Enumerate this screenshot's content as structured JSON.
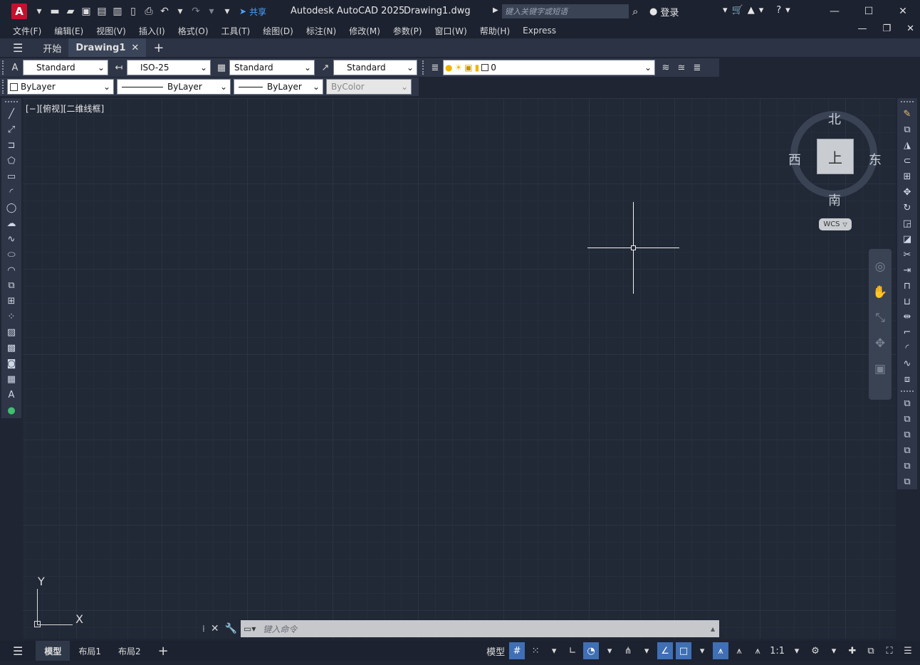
{
  "titlebar": {
    "logo": "A",
    "share_label": "共享",
    "app_title": "Autodesk AutoCAD 2025",
    "doc_title": "Drawing1.dwg",
    "search_placeholder": "键入关键字或短语",
    "login_label": "登录"
  },
  "menu": {
    "items": [
      "文件(F)",
      "编辑(E)",
      "视图(V)",
      "插入(I)",
      "格式(O)",
      "工具(T)",
      "绘图(D)",
      "标注(N)",
      "修改(M)",
      "参数(P)",
      "窗口(W)",
      "帮助(H)",
      "Express"
    ]
  },
  "tabs": {
    "start": "开始",
    "drawing": "Drawing1"
  },
  "toolbar1": {
    "text_style": "Standard",
    "dim_style": "ISO-25",
    "table_style": "Standard",
    "mleader_style": "Standard",
    "layer": "0"
  },
  "toolbar2": {
    "color": "ByLayer",
    "linetype": "ByLayer",
    "lineweight": "ByLayer",
    "plotstyle": "ByColor"
  },
  "viewport": {
    "label": "[−][俯视][二维线框]"
  },
  "viewcube": {
    "north": "北",
    "south": "南",
    "east": "东",
    "west": "西",
    "face": "上",
    "wcs": "WCS"
  },
  "ucs": {
    "x": "X",
    "y": "Y"
  },
  "command": {
    "placeholder": "键入命令"
  },
  "status": {
    "model_tab": "模型",
    "layout1": "布局1",
    "layout2": "布局2",
    "model_btn": "模型",
    "scale": "1:1"
  },
  "colors": {
    "canvas": "#212836",
    "accent": "#3f6fb5",
    "logo": "#c8102e"
  }
}
